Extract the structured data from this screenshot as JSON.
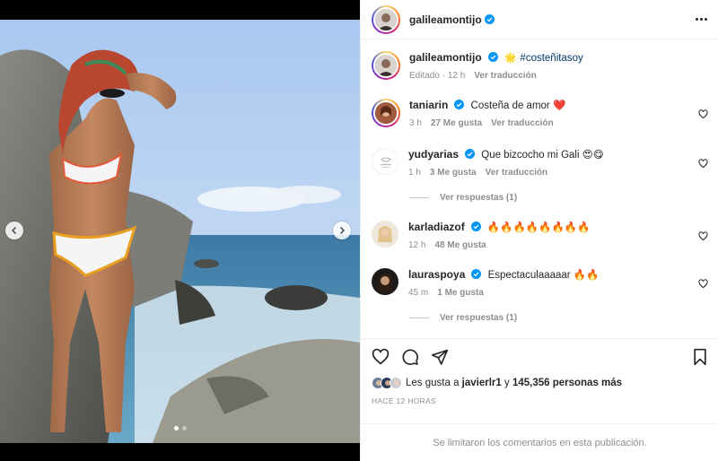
{
  "post": {
    "author": "galileamontijo",
    "more_icon": "more-horizontal-icon",
    "caption": {
      "username": "galileamontijo",
      "emoji": "🌟",
      "hashtag": "#costeñitasoy",
      "edited": "Editado",
      "time": "12 h",
      "translate": "Ver traducción"
    }
  },
  "comments": [
    {
      "username": "taniarin",
      "text": "Costeña de amor ❤️",
      "time": "3 h",
      "likes": "27 Me gusta",
      "translate": "Ver traducción",
      "replies": ""
    },
    {
      "username": "yudyarias",
      "text": "Que bizcocho mi Gali 😍😋",
      "time": "1 h",
      "likes": "3 Me gusta",
      "translate": "Ver traducción",
      "replies": "Ver respuestas (1)"
    },
    {
      "username": "karladiazof",
      "text": "🔥🔥🔥🔥🔥🔥🔥🔥",
      "time": "12 h",
      "likes": "48 Me gusta",
      "translate": "",
      "replies": ""
    },
    {
      "username": "lauraspoya",
      "text": "Espectaculaaaaar 🔥🔥",
      "time": "45 m",
      "likes": "1 Me gusta",
      "translate": "",
      "replies": "Ver respuestas (1)"
    }
  ],
  "likes": {
    "prefix": "Les gusta a",
    "first_user": "javierlr1",
    "connector": "y",
    "count": "145,356 personas más"
  },
  "timestamp": "HACE 12 HORAS",
  "comments_limited": "Se limitaron los comentarios en esta publicación.",
  "carousel": {
    "total": 2,
    "active": 1
  },
  "colors": {
    "verified": "#0095f6",
    "link": "#00376b",
    "muted": "#8e8e8e",
    "text": "#262626"
  }
}
